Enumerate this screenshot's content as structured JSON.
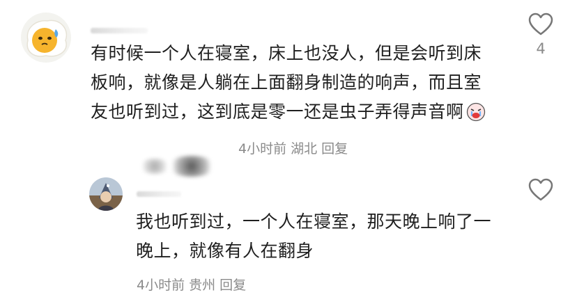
{
  "comments": [
    {
      "text": "有时候一个人在寝室，床上也没人，但是会听到床板响，就像是人躺在上面翻身制造的响声，而且室友也听到过，这到底是零一还是虫子弄得声音啊",
      "time": "4小时前",
      "location": "湖北",
      "reply_label": "回复",
      "like_count": "4",
      "emoji_icon": "crying-face-icon",
      "avatar_icon": "fried-egg-avatar-icon"
    },
    {
      "text": "我也听到过，一个人在寝室，那天晚上响了一晚上，就像有人在翻身",
      "time": "4小时前",
      "location": "贵州",
      "reply_label": "回复",
      "like_count": "",
      "avatar_icon": "anime-character-avatar-icon"
    }
  ],
  "colors": {
    "text": "#1f1f1f",
    "meta": "#8a8a8a",
    "icon_stroke": "#777777"
  }
}
